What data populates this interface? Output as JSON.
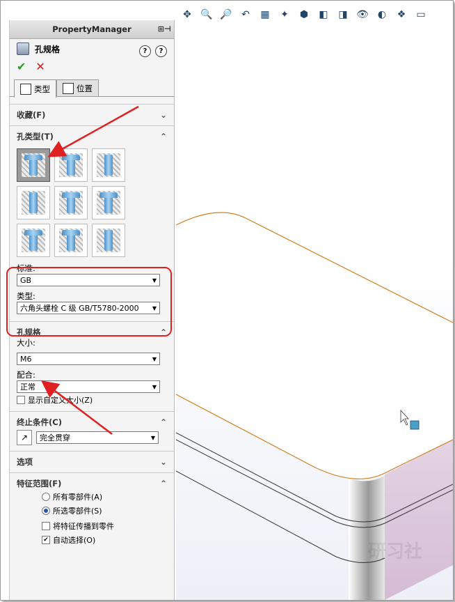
{
  "pm": {
    "header": "PropertyManager",
    "feature_title": "孔规格",
    "tabs": [
      {
        "label": "类型"
      },
      {
        "label": "位置"
      }
    ],
    "favorites": "收藏(F)",
    "hole_type": "孔类型(T)",
    "standard_label": "标准:",
    "standard_value": "GB",
    "type_label": "类型:",
    "type_value": "六角头螺栓 C 级 GB/T5780-2000",
    "spec_head": "孔规格",
    "size_label": "大小:",
    "size_value": "M6",
    "fit_label": "配合:",
    "fit_value": "正常",
    "custom_size": "显示自定义大小(Z)",
    "end_head": "终止条件(C)",
    "end_value": "完全贯穿",
    "options_head": "选项",
    "scope_head": "特征范围(F)",
    "scope_all": "所有零部件(A)",
    "scope_selected": "所选零部件(S)",
    "propagate": "将特征传播到零件",
    "auto_select": "自动选择(O)"
  },
  "colors": {
    "arrow": "#e02020",
    "edge": "#d08020",
    "accent": "#2a9a2a"
  }
}
